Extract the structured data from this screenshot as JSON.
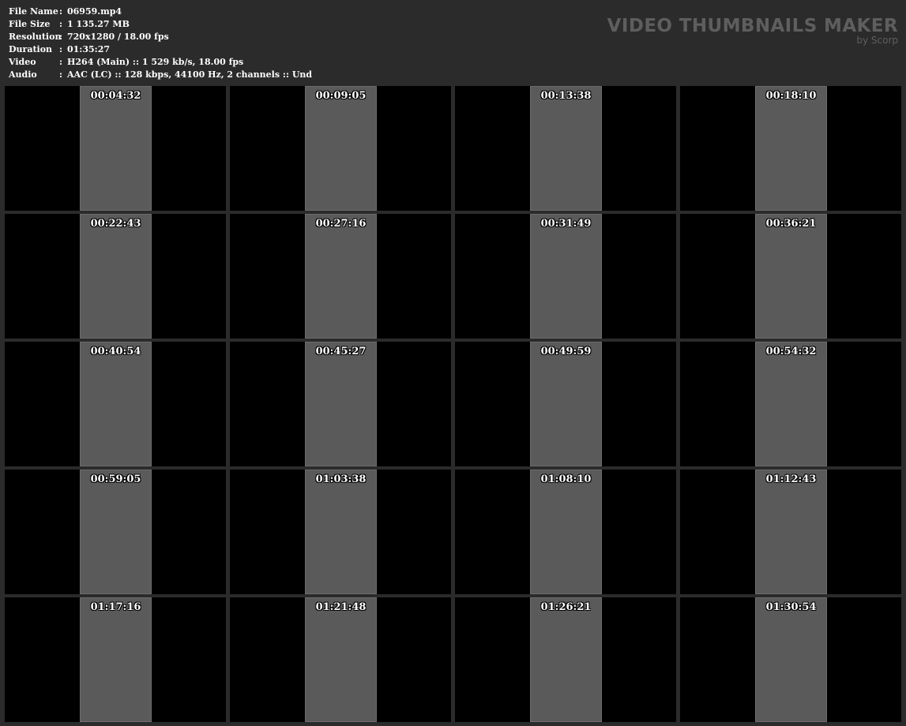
{
  "info": [
    {
      "label": "File Name",
      "value": "06959.mp4"
    },
    {
      "label": "File Size",
      "value": "1 135.27 MB"
    },
    {
      "label": "Resolution",
      "value": "720x1280 / 18.00 fps"
    },
    {
      "label": "Duration",
      "value": "01:35:27"
    },
    {
      "label": "Video",
      "value": "H264 (Main) :: 1 529 kb/s, 18.00 fps"
    },
    {
      "label": "Audio",
      "value": "AAC (LC) :: 128 kbps, 44100 Hz, 2 channels :: Und"
    }
  ],
  "separator": ":",
  "brand": {
    "title": "VIDEO THUMBNAILS MAKER",
    "subtitle": "by Scorp"
  },
  "timestamps": [
    "00:04:32",
    "00:09:05",
    "00:13:38",
    "00:18:10",
    "00:22:43",
    "00:27:16",
    "00:31:49",
    "00:36:21",
    "00:40:54",
    "00:45:27",
    "00:49:59",
    "00:54:32",
    "00:59:05",
    "01:03:38",
    "01:08:10",
    "01:12:43",
    "01:17:16",
    "01:21:48",
    "01:26:21",
    "01:30:54"
  ]
}
